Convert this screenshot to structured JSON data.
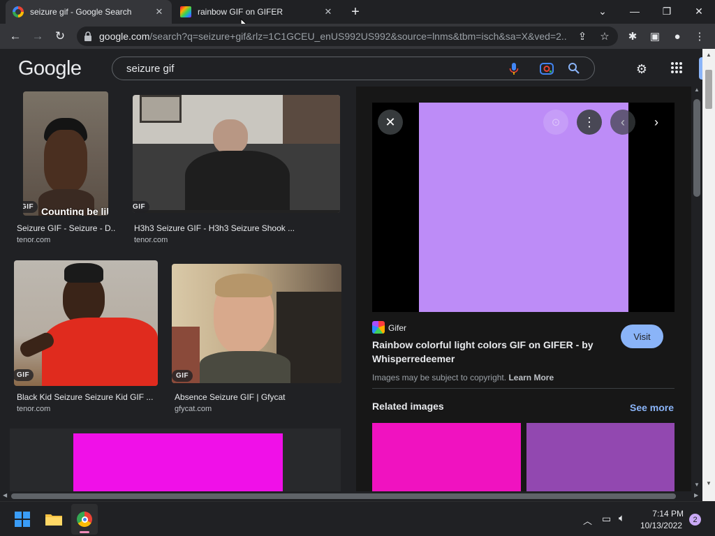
{
  "browser": {
    "tabs": [
      {
        "title": "seizure gif - Google Search",
        "favicon": "google-g-icon"
      },
      {
        "title": "rainbow GIF on GIFER",
        "favicon": "gifer-rainbow-icon"
      }
    ],
    "url_domain": "google.com",
    "url_path": "/search?q=seizure+gif&rlz=1C1GCEU_enUS992US992&source=lnms&tbm=isch&sa=X&ved=2..."
  },
  "google": {
    "logo": "Google",
    "search_query": "seizure gif"
  },
  "results": [
    {
      "title": "Seizure GIF - Seizure - D...",
      "source": "tenor.com",
      "badge": "GIF",
      "caption": "Counting be like"
    },
    {
      "title": "H3h3 Seizure GIF - H3h3 Seizure Shook ...",
      "source": "tenor.com",
      "badge": "GIF"
    },
    {
      "title": "Black Kid Seizure Seizure Kid GIF ...",
      "source": "tenor.com",
      "badge": "GIF"
    },
    {
      "title": "Absence Seizure GIF | Gfycat",
      "source": "gfycat.com",
      "badge": "GIF"
    }
  ],
  "panel": {
    "site": "Gifer",
    "title": "Rainbow colorful light colors GIF on GIFER - by Whisperredeemer",
    "visit_label": "Visit",
    "copyright": "Images may be subject to copyright.",
    "learn_more": "Learn More",
    "related_heading": "Related images",
    "see_more": "See more"
  },
  "taskbar": {
    "time": "7:14 PM",
    "date": "10/13/2022",
    "notification_count": "2"
  },
  "colors": {
    "preview_fill": "#bd8cf7",
    "placeholder_fill": "#f010e8",
    "related_1": "#f012c0",
    "related_2": "#9248b0",
    "link": "#8ab4f8",
    "visit_button": "#8ab4f8"
  }
}
